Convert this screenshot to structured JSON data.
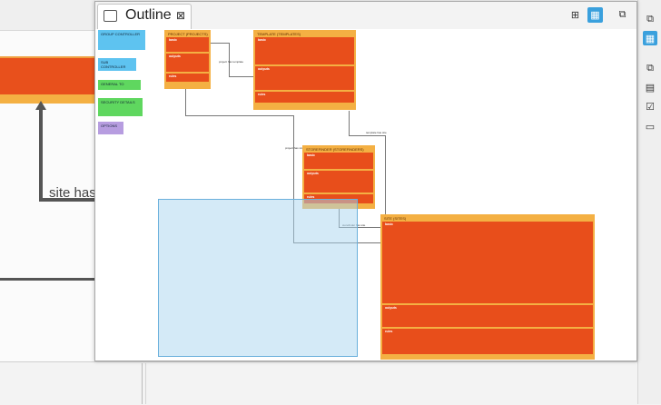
{
  "background_editor": {
    "edge_label": "site has"
  },
  "outline": {
    "title": "Outline",
    "close_label": "⊠"
  },
  "legend": [
    {
      "label": "GROUP CONTROLLER",
      "sub": "",
      "color": "#5ec3f0"
    },
    {
      "label": "SUB CONTROLLER",
      "sub": "",
      "color": "#5ec3f0"
    },
    {
      "label": "GENERAL TO",
      "sub": "",
      "color": "#5fd75f"
    },
    {
      "label": "SECURITY DETAILS",
      "sub": "",
      "color": "#5fd75f"
    },
    {
      "label": "OPTIONS",
      "sub": "",
      "color": "#b79de0"
    }
  ],
  "entities": {
    "project": {
      "title": "PROJECT (PROJECTS)",
      "sections": [
        "basic",
        "outputs",
        "rules"
      ]
    },
    "template": {
      "title": "TEMPLATE (TEMPLATES)",
      "sections": [
        "basic",
        "outputs",
        "rules"
      ]
    },
    "storefinder": {
      "title": "STOREFINDER (STOREFINDERS)",
      "sections": [
        "basic",
        "outputs",
        "rules"
      ]
    },
    "site": {
      "title": "SITE (SITES)",
      "sections": [
        "basic",
        "outputs",
        "rules"
      ]
    }
  },
  "connections": [
    {
      "label": "project has template"
    },
    {
      "label": "template has site"
    },
    {
      "label": "project has storefinder"
    },
    {
      "label": "storefinder has site"
    }
  ],
  "colors": {
    "entity_header": "#f4b043",
    "entity_body": "#e84e1b",
    "accent": "#3aa0dd",
    "viewport": "#aad6f0"
  }
}
